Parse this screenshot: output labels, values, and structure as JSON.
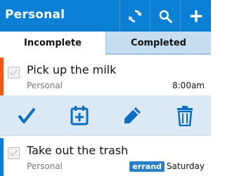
{
  "appbar": {
    "title": "Personal",
    "actions": [
      {
        "icon": "refresh-icon"
      },
      {
        "icon": "search-icon"
      },
      {
        "icon": "plus-icon"
      }
    ]
  },
  "tabs": [
    {
      "label": "Incomplete",
      "active": true
    },
    {
      "label": "Completed",
      "active": false
    }
  ],
  "tasks": [
    {
      "title": "Pick up the milk",
      "list": "Personal",
      "due": "8:00am",
      "tag": "",
      "stripe_color": "#f0571c"
    },
    {
      "title": "Take out the trash",
      "list": "Personal",
      "due": "Saturday",
      "tag": "errand",
      "stripe_color": "#0a7fd4"
    }
  ],
  "action_bar": [
    {
      "icon": "checkmark-icon"
    },
    {
      "icon": "calendar-add-icon"
    },
    {
      "icon": "pencil-icon"
    },
    {
      "icon": "trash-icon"
    }
  ],
  "colors": {
    "accent": "#0a7fd4",
    "priority_high": "#f0571c",
    "action_bar_bg": "#dbe9f6",
    "tag_bg": "#2a7fc9"
  }
}
